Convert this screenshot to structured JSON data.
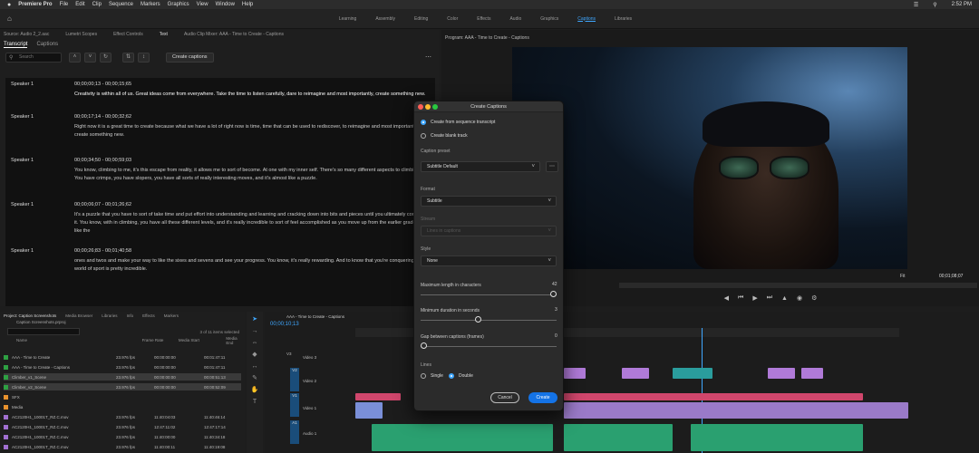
{
  "menubar": {
    "apple": "",
    "items": [
      "Premiere Pro",
      "File",
      "Edit",
      "Clip",
      "Sequence",
      "Markers",
      "Graphics",
      "View",
      "Window",
      "Help"
    ],
    "time": "2:52 PM"
  },
  "workspaces": [
    "Learning",
    "Assembly",
    "Editing",
    "Color",
    "Effects",
    "Audio",
    "Graphics",
    "Captions",
    "Libraries"
  ],
  "source_panel": {
    "tabs": [
      "Source: Audio 2_2.aac",
      "Lumetri Scopes",
      "Effect Controls",
      "Text",
      "Audio Clip Mixer: AAA - Time to Create - Captions"
    ],
    "subtabs": [
      "Transcript",
      "Captions"
    ],
    "search_placeholder": "Search",
    "create_captions": "Create captions",
    "segments": [
      {
        "speaker": "Speaker 1",
        "timecode": "00;00;00;13 - 00;00;15;65",
        "text": "Creativity is within all of us. Great ideas come from everywhere. Take the time to listen carefully, dare to reimagine and most importantly, create something new."
      },
      {
        "speaker": "Speaker 1",
        "timecode": "00;00;17;14 - 00;00;32;62",
        "text": "Right now it is a great time to create because what we have a lot of right now is time, time that can be used to rediscover, to reimagine and most importantly, create something new."
      },
      {
        "speaker": "Speaker 1",
        "timecode": "00;00;34;50 - 00;00;59;03",
        "text": "You know, climbing to me, it's this escape from reality, it allows me to sort of become. At one with my inner self. There's so many different aspects to climbing. You have crimps, you have slopers, you have all sorts of really interesting moves, and it's almost like a puzzle."
      },
      {
        "speaker": "Speaker 1",
        "timecode": "00;00;06;07 - 00;01;26;62",
        "text": "It's a puzzle that you have to sort of take time and put effort into understanding and learning and cracking down into bits and pieces until you ultimately conquer it. You know, with in climbing, you have all these different levels, and it's really incredible to sort of feel accomplished as you move up from the earlier grades, like the"
      },
      {
        "speaker": "Speaker 1",
        "timecode": "00;00;26;83 - 00;01;40;58",
        "text": "ones and twos and make your way to like the sixes and sevens and see your progress. You know, it's really rewarding. And to know that you're conquering the world of sport is pretty incredible."
      }
    ]
  },
  "program": {
    "title": "Program: AAA - Time to Create - Captions",
    "fit": "Fit",
    "timecode": "00;01;08;07"
  },
  "project_panel": {
    "tabs": [
      "Project: Caption Screenshots",
      "Media Browser",
      "Libraries",
      "Info",
      "Effects",
      "Markers"
    ],
    "file": "Caption Screenshots.prproj",
    "items_selected": "3 of 11 items selected",
    "columns": [
      "Name",
      "Frame Rate",
      "Media Start",
      "Media End"
    ],
    "rows": [
      {
        "name": "AAA - Time to Create",
        "rate": "23.976 fps",
        "start": "00:00:00:00",
        "end": "00:01:47:11",
        "color": "#2ea043"
      },
      {
        "name": "AAA - Time to Create - Captions",
        "rate": "23.976 fps",
        "start": "00:00:00:00",
        "end": "00:01:47:11",
        "color": "#2ea043"
      },
      {
        "name": "Climber_v1_Scene",
        "rate": "23.976 fps",
        "start": "00:00:00:00",
        "end": "00:00:51:13",
        "color": "#2ea043"
      },
      {
        "name": "Climber_v2_Scene",
        "rate": "23.976 fps",
        "start": "00:00:00:00",
        "end": "00:00:52:09",
        "color": "#2ea043"
      },
      {
        "name": "SFX",
        "rate": "",
        "start": "",
        "end": "",
        "color": "#e8912d"
      },
      {
        "name": "Media",
        "rate": "",
        "start": "",
        "end": "",
        "color": "#e8912d"
      },
      {
        "name": "AC2120H1_10001T_RZ.C.mov",
        "rate": "23.976 fps",
        "start": "11:40:04:03",
        "end": "11:40:46:14",
        "color": "#a070d0"
      },
      {
        "name": "AC2120H1_10001T_RZ.C.mov",
        "rate": "23.976 fps",
        "start": "12:47:11:02",
        "end": "12:47:17:14",
        "color": "#a070d0"
      },
      {
        "name": "AC2120H1_10001T_RZ.C.mov",
        "rate": "23.976 fps",
        "start": "11:40:00:00",
        "end": "11:40:34:18",
        "color": "#a070d0"
      },
      {
        "name": "AC2120H1_10001T_RZ.C.mov",
        "rate": "23.976 fps",
        "start": "11:40:00:11",
        "end": "11:40:19:08",
        "color": "#a070d0"
      }
    ]
  },
  "timeline": {
    "title": "AAA - Time to Create - Captions",
    "timecode": "00;00;10;13",
    "tracks": [
      "Video 3",
      "Video 2",
      "Video 1",
      "Audio 1"
    ],
    "track_ids": [
      "V3",
      "V2",
      "V1",
      "A1"
    ]
  },
  "dialog": {
    "title": "Create Captions",
    "options": [
      "Create from sequence transcript",
      "Create blank track"
    ],
    "caption_preset_label": "Caption preset",
    "caption_preset": "Subtitle Default",
    "format_label": "Format",
    "format": "Subtitle",
    "stream_label": "Stream",
    "stream": "Lines in captions",
    "style_label": "Style",
    "style": "None",
    "max_length_label": "Maximum length in characters",
    "max_length": "42",
    "max_length_fraction": 1.0,
    "min_duration_label": "Minimum duration in seconds",
    "min_duration": "3",
    "min_duration_fraction": 0.42,
    "gap_label": "Gap between captions (frames)",
    "gap": "0",
    "gap_fraction": 0.0,
    "lines_label": "Lines",
    "lines_options": [
      "Single",
      "Double"
    ],
    "cancel": "Cancel",
    "create": "Create"
  }
}
